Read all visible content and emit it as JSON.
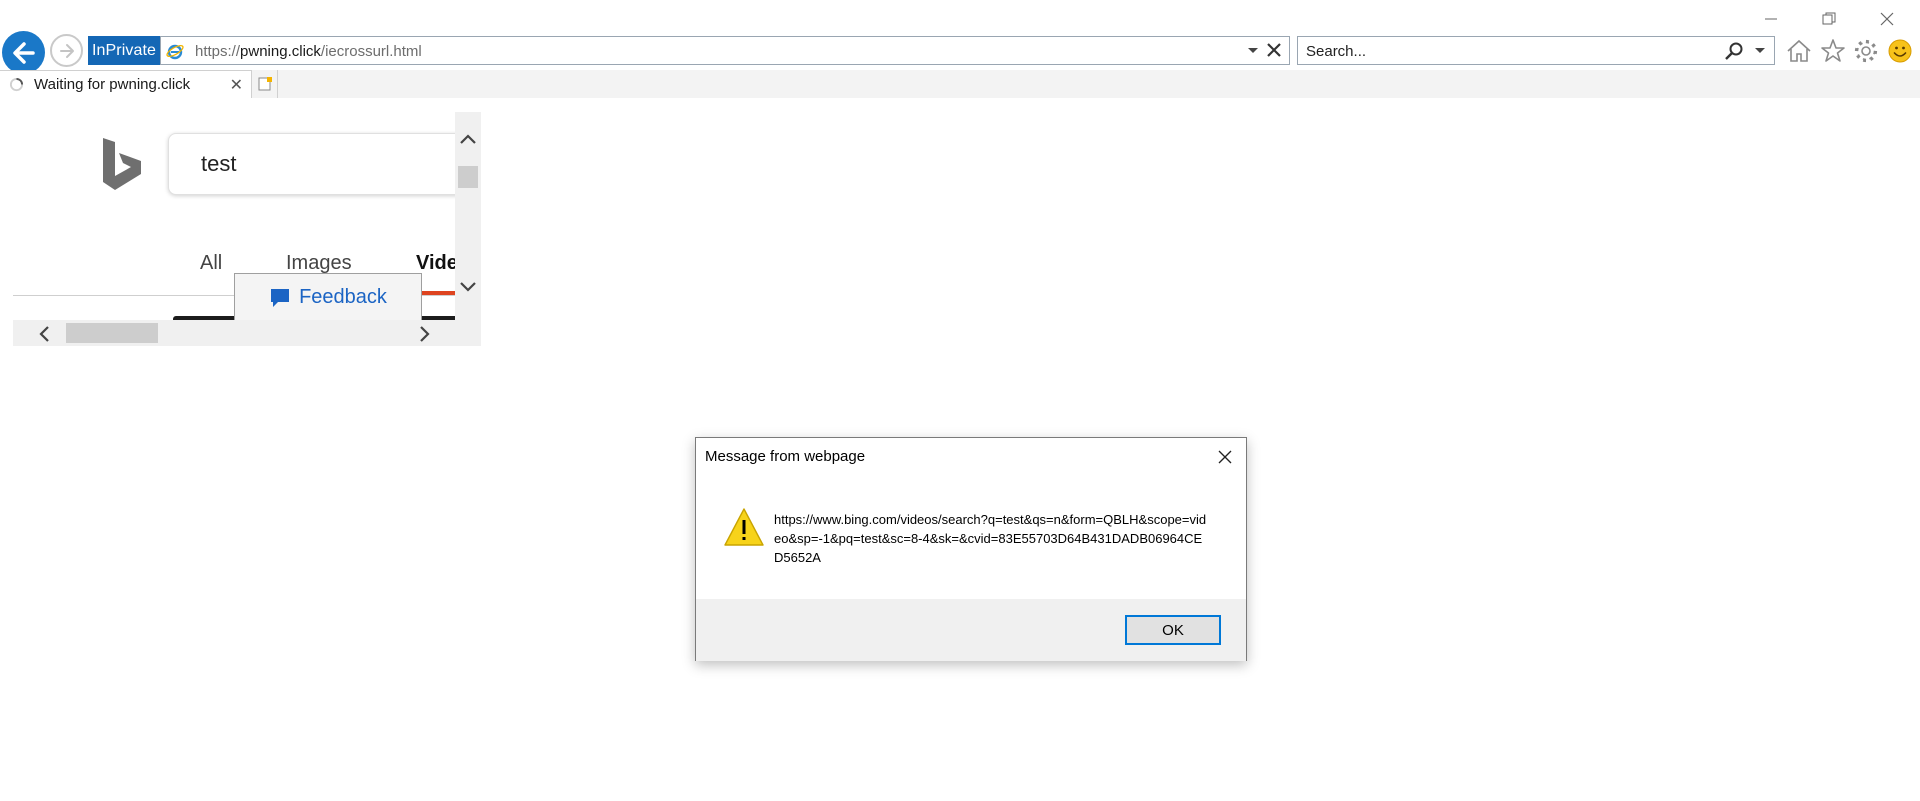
{
  "window": {
    "minimize_glyph": "—",
    "restore_glyph": "❐",
    "close_glyph": "✕"
  },
  "nav": {
    "back_icon": "back-arrow-icon",
    "forward_icon": "forward-arrow-icon",
    "inprivate_label": "InPrivate",
    "address": {
      "scheme": "https://",
      "host": "pwning.click",
      "path": "/iecrossurl.html"
    },
    "search_placeholder": "Search...",
    "toolbar_icons": [
      "home-icon",
      "favorites-star-icon",
      "tools-gear-icon",
      "feedback-smiley-icon"
    ]
  },
  "tabs": [
    {
      "label": "Waiting for pwning.click",
      "close_glyph": "✕"
    }
  ],
  "frame": {
    "search_query": "test",
    "nav_tabs": [
      "All",
      "Images",
      "Vide"
    ],
    "feedback_label": "Feedback"
  },
  "dialog": {
    "title": "Message from webpage",
    "message": "https://www.bing.com/videos/search?q=test&qs=n&form=QBLH&scope=video&sp=-1&pq=test&sc=8-4&sk=&cvid=83E55703D64B431DADB06964CED5652A",
    "ok_label": "OK",
    "close_glyph": "✕"
  },
  "colors": {
    "accent": "#1a78c8",
    "inprivate_bg": "#1467b5",
    "bing_red": "#de4420",
    "link_blue": "#1b64c4",
    "warning_yellow": "#f7d31a"
  }
}
